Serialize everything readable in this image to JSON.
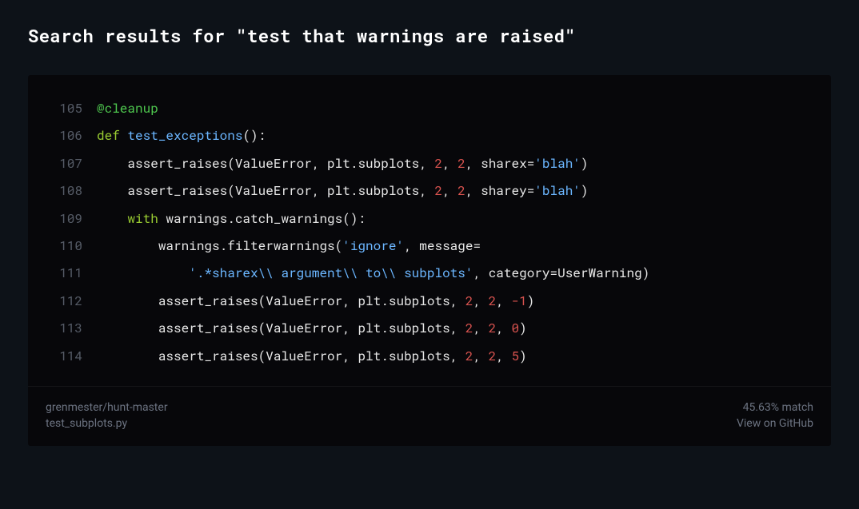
{
  "header": {
    "title": "Search results for \"test that warnings are raised\""
  },
  "code": {
    "lines": [
      {
        "num": "105",
        "tokens": [
          {
            "cls": "tok-decorator",
            "text": "@cleanup"
          }
        ]
      },
      {
        "num": "106",
        "tokens": [
          {
            "cls": "tok-keyword",
            "text": "def"
          },
          {
            "cls": "tok-default",
            "text": " "
          },
          {
            "cls": "tok-funcname",
            "text": "test_exceptions"
          },
          {
            "cls": "tok-default",
            "text": "():"
          }
        ]
      },
      {
        "num": "107",
        "tokens": [
          {
            "cls": "tok-default",
            "text": "    assert_raises(ValueError, plt.subplots, "
          },
          {
            "cls": "tok-number",
            "text": "2"
          },
          {
            "cls": "tok-default",
            "text": ", "
          },
          {
            "cls": "tok-number",
            "text": "2"
          },
          {
            "cls": "tok-default",
            "text": ", sharex="
          },
          {
            "cls": "tok-string",
            "text": "'blah'"
          },
          {
            "cls": "tok-default",
            "text": ")"
          }
        ]
      },
      {
        "num": "108",
        "tokens": [
          {
            "cls": "tok-default",
            "text": "    assert_raises(ValueError, plt.subplots, "
          },
          {
            "cls": "tok-number",
            "text": "2"
          },
          {
            "cls": "tok-default",
            "text": ", "
          },
          {
            "cls": "tok-number",
            "text": "2"
          },
          {
            "cls": "tok-default",
            "text": ", sharey="
          },
          {
            "cls": "tok-string",
            "text": "'blah'"
          },
          {
            "cls": "tok-default",
            "text": ")"
          }
        ]
      },
      {
        "num": "109",
        "tokens": [
          {
            "cls": "tok-default",
            "text": "    "
          },
          {
            "cls": "tok-keyword",
            "text": "with"
          },
          {
            "cls": "tok-default",
            "text": " warnings.catch_warnings():"
          }
        ]
      },
      {
        "num": "110",
        "tokens": [
          {
            "cls": "tok-default",
            "text": "        warnings.filterwarnings("
          },
          {
            "cls": "tok-string",
            "text": "'ignore'"
          },
          {
            "cls": "tok-default",
            "text": ", message="
          }
        ]
      },
      {
        "num": "111",
        "tokens": [
          {
            "cls": "tok-default",
            "text": "            "
          },
          {
            "cls": "tok-string",
            "text": "'.*sharex\\\\ argument\\\\ to\\\\ subplots'"
          },
          {
            "cls": "tok-default",
            "text": ", category=UserWarning)"
          }
        ]
      },
      {
        "num": "112",
        "tokens": [
          {
            "cls": "tok-default",
            "text": "        assert_raises(ValueError, plt.subplots, "
          },
          {
            "cls": "tok-number",
            "text": "2"
          },
          {
            "cls": "tok-default",
            "text": ", "
          },
          {
            "cls": "tok-number",
            "text": "2"
          },
          {
            "cls": "tok-default",
            "text": ", "
          },
          {
            "cls": "tok-number",
            "text": "-1"
          },
          {
            "cls": "tok-default",
            "text": ")"
          }
        ]
      },
      {
        "num": "113",
        "tokens": [
          {
            "cls": "tok-default",
            "text": "        assert_raises(ValueError, plt.subplots, "
          },
          {
            "cls": "tok-number",
            "text": "2"
          },
          {
            "cls": "tok-default",
            "text": ", "
          },
          {
            "cls": "tok-number",
            "text": "2"
          },
          {
            "cls": "tok-default",
            "text": ", "
          },
          {
            "cls": "tok-number",
            "text": "0"
          },
          {
            "cls": "tok-default",
            "text": ")"
          }
        ]
      },
      {
        "num": "114",
        "tokens": [
          {
            "cls": "tok-default",
            "text": "        assert_raises(ValueError, plt.subplots, "
          },
          {
            "cls": "tok-number",
            "text": "2"
          },
          {
            "cls": "tok-default",
            "text": ", "
          },
          {
            "cls": "tok-number",
            "text": "2"
          },
          {
            "cls": "tok-default",
            "text": ", "
          },
          {
            "cls": "tok-number",
            "text": "5"
          },
          {
            "cls": "tok-default",
            "text": ")"
          }
        ]
      }
    ]
  },
  "footer": {
    "repo": "grenmester/hunt-master",
    "file": "test_subplots.py",
    "match": "45.63% match",
    "github_link": "View on GitHub"
  }
}
